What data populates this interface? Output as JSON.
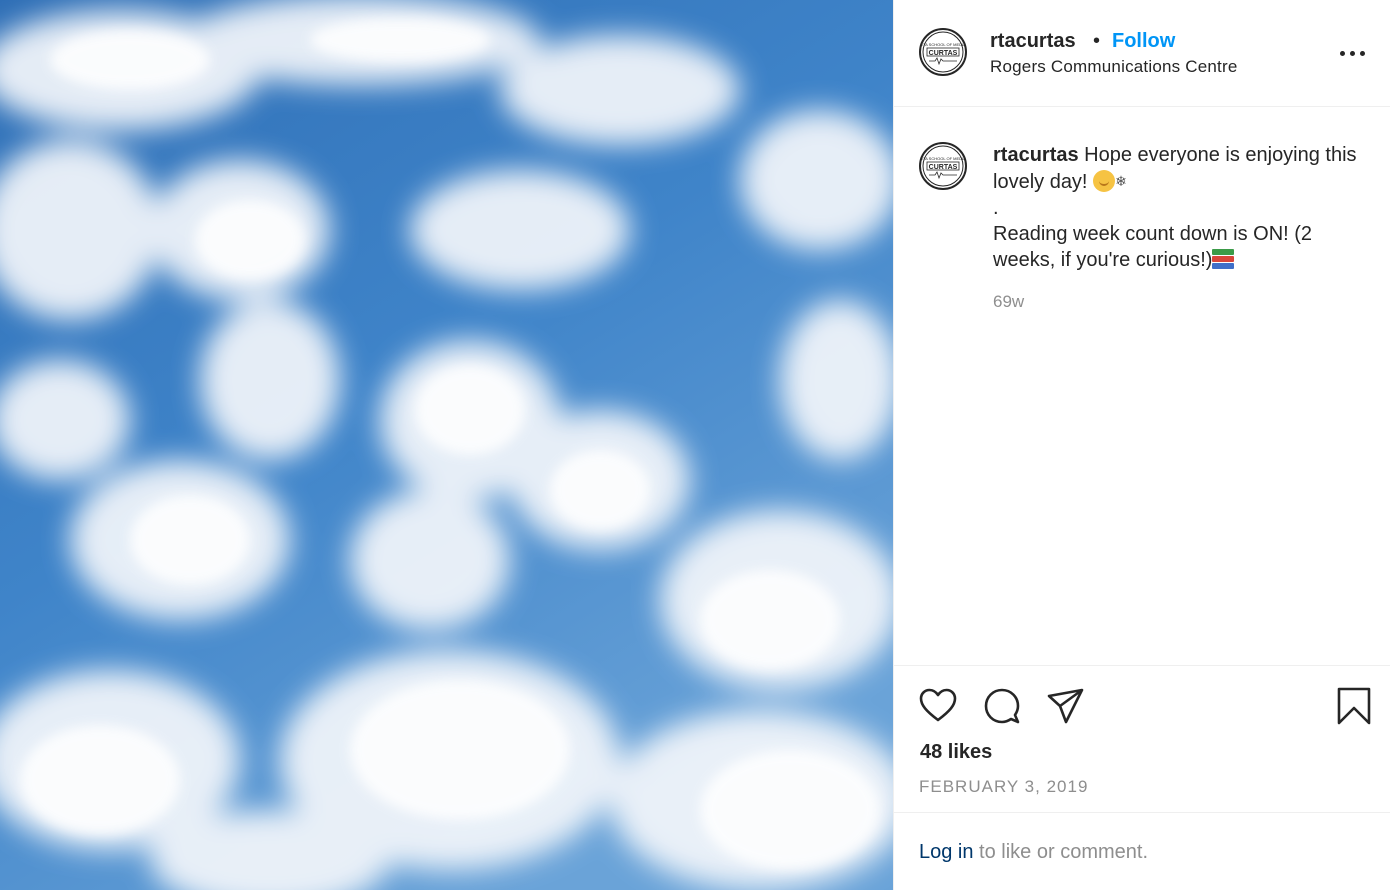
{
  "post": {
    "username": "rtacurtas",
    "separator": "•",
    "follow_label": "Follow",
    "location": "Rogers Communications Centre",
    "avatar_logo_text": "CURTAS",
    "caption_line1": "Hope everyone is enjoying this lovely day!",
    "caption_line1_emoji": [
      "sun-face-emoji",
      "snowflake-emoji"
    ],
    "caption_dot": ".",
    "caption_line2": "Reading week count down is ON! (2 weeks, if you're curious!)",
    "caption_line2_emoji": [
      "books-emoji"
    ],
    "time_ago": "69w",
    "likes": "48 likes",
    "date": "FEBRUARY 3, 2019"
  },
  "actions": {
    "icons": [
      "heart-icon",
      "comment-icon",
      "share-icon",
      "bookmark-icon",
      "more-options-icon"
    ]
  },
  "footer": {
    "login_link": "Log in",
    "login_rest": " to like or comment."
  },
  "colors": {
    "accent_blue": "#0095f6",
    "link_dark_blue": "#00376b",
    "text": "#262626",
    "secondary_text": "#8e8e8e",
    "divider": "#efefef",
    "sky": "#3f7fc4"
  },
  "image": {
    "subject": "blue sky with scattered white clouds"
  }
}
